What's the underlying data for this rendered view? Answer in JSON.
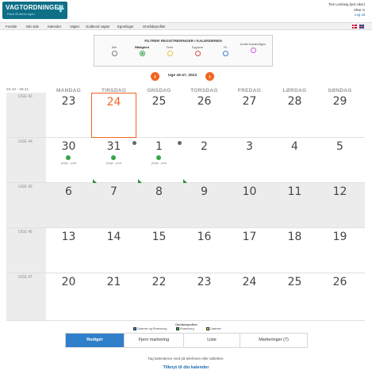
{
  "header": {
    "logo_text": "VAGTORDNINGEN",
    "logo_sub": "Flere få deres egen",
    "user_name": "Tine Lembeig (test viker)",
    "user_line2": "Vikar m",
    "logout": "Log ud"
  },
  "nav": {
    "items": [
      "Forside",
      "Min side",
      "Kalender",
      "Vagter",
      "Godkend vagter",
      "Egnelinger",
      "Områdeprofiler"
    ]
  },
  "filter": {
    "title": "FILTRER REGISTRERINGER I KALENDEREN",
    "options": [
      {
        "label": "Alle",
        "color": "#777777",
        "selected": false
      },
      {
        "label": "Rådighed",
        "color": "#3aa346",
        "selected": true
      },
      {
        "label": "Ferie",
        "color": "#e2c23a",
        "selected": false
      },
      {
        "label": "Sygdom",
        "color": "#e0483e",
        "selected": false
      },
      {
        "label": "Fri",
        "color": "#3a7ad8",
        "selected": false
      },
      {
        "label": "Andet fravær/ågen",
        "color": "#c45ad1",
        "selected": false
      }
    ]
  },
  "week_nav": {
    "prev": "‹",
    "label": "Uge 43-47, 2023",
    "next": "›"
  },
  "calendar": {
    "range": "23.10 - 26.11",
    "days": [
      "MANDAG",
      "TIRSDAG",
      "ONSDAG",
      "TORSDAG",
      "FREDAG",
      "LØRDAG",
      "SØNDAG"
    ],
    "weeks": [
      {
        "label": "UGE 43",
        "dates": [
          "23",
          "24",
          "25",
          "26",
          "27",
          "28",
          "29"
        ]
      },
      {
        "label": "UGE 44",
        "dates": [
          "30",
          "31",
          "1",
          "2",
          "3",
          "4",
          "5"
        ]
      },
      {
        "label": "UGE 45",
        "dates": [
          "6",
          "7",
          "8",
          "9",
          "10",
          "11",
          "12"
        ]
      },
      {
        "label": "UGE 46",
        "dates": [
          "13",
          "14",
          "15",
          "16",
          "17",
          "18",
          "19"
        ]
      },
      {
        "label": "UGE 47",
        "dates": [
          "20",
          "21",
          "22",
          "23",
          "24",
          "25",
          "26"
        ]
      }
    ],
    "event_label": "yhdge - pudx"
  },
  "legend": {
    "title": "Områdeprofiler",
    "items": [
      "Datemer og Rosenborg",
      "Rosenborg",
      "Datemer"
    ],
    "colors": [
      "#2f7ec9",
      "#3aa346",
      "#e2c23a"
    ]
  },
  "tabs": [
    {
      "label": "Redigér",
      "active": true
    },
    {
      "label": "Fjern markering",
      "active": false
    },
    {
      "label": "Liste",
      "active": false
    },
    {
      "label": "Markeringer (7)",
      "active": false
    }
  ],
  "hint": "Tag kalenderen med på telefonen eller tabletten.",
  "calendar_link": "Tilknyt til din kalender",
  "colors": {
    "accent": "#f26522",
    "primary": "#2f7ec9",
    "brand": "#0e6f86",
    "available": "#3aa346"
  }
}
